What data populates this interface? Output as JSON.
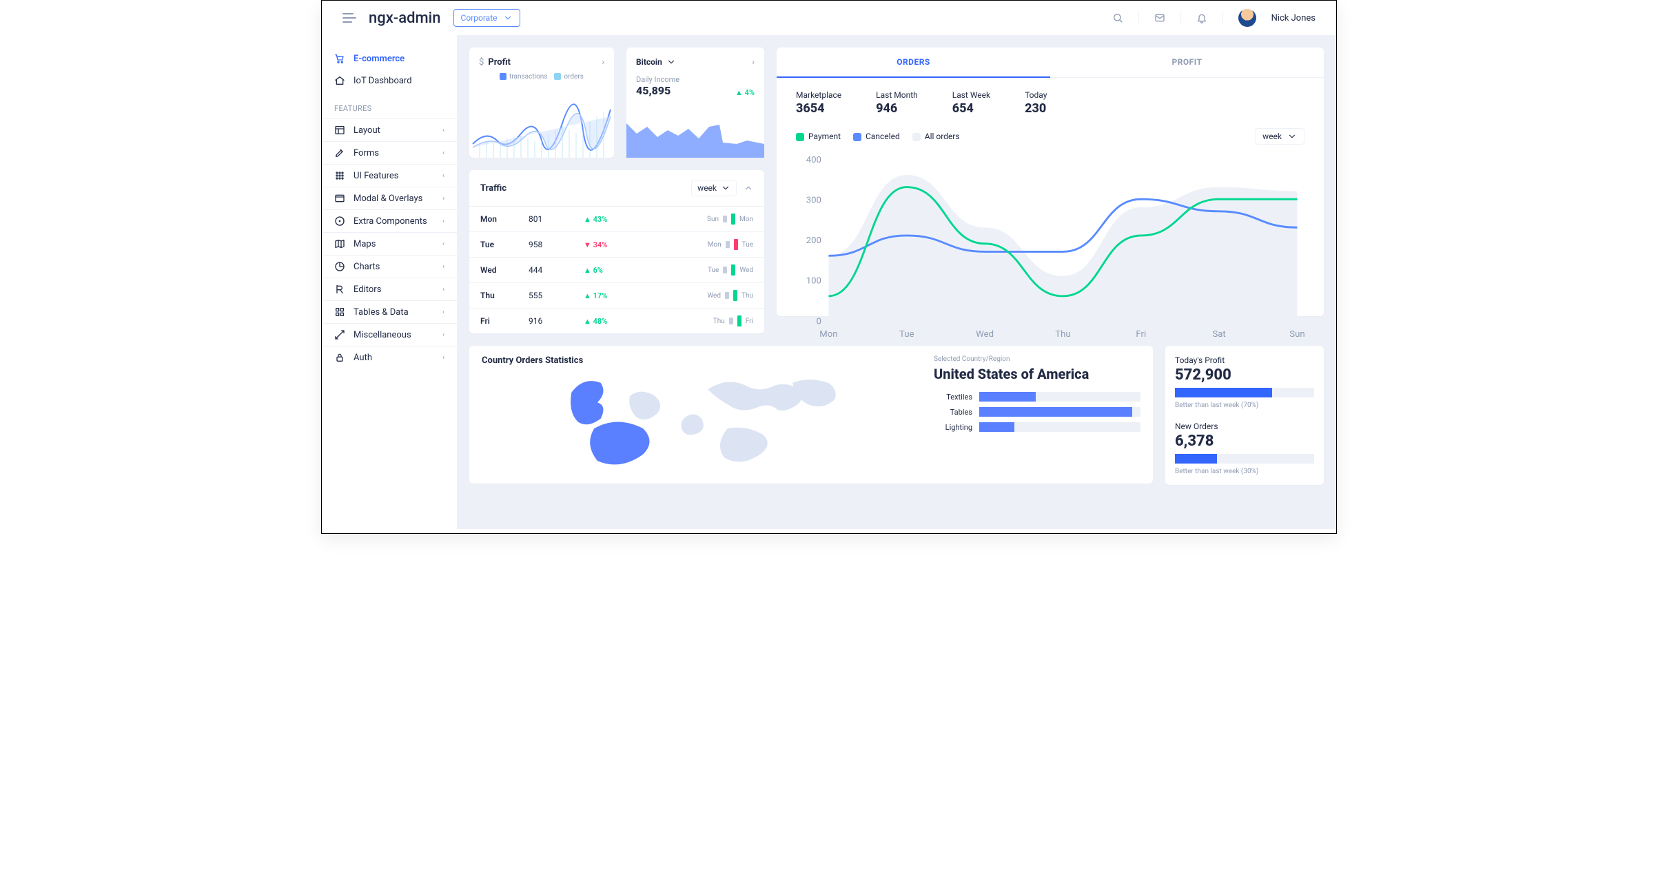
{
  "header": {
    "brand": "ngx-admin",
    "theme": "Corporate",
    "user": "Nick Jones"
  },
  "sidebar": {
    "items_top": [
      {
        "icon": "cart",
        "label": "E-commerce",
        "active": true
      },
      {
        "icon": "home",
        "label": "IoT Dashboard"
      }
    ],
    "features_label": "FEATURES",
    "items_features": [
      {
        "icon": "layout",
        "label": "Layout",
        "expandable": true
      },
      {
        "icon": "forms",
        "label": "Forms",
        "expandable": true
      },
      {
        "icon": "uif",
        "label": "UI Features",
        "expandable": true
      },
      {
        "icon": "modal",
        "label": "Modal & Overlays",
        "expandable": true
      },
      {
        "icon": "extra",
        "label": "Extra Components",
        "expandable": true
      },
      {
        "icon": "maps",
        "label": "Maps",
        "expandable": true
      },
      {
        "icon": "charts",
        "label": "Charts",
        "expandable": true
      },
      {
        "icon": "editors",
        "label": "Editors",
        "expandable": true
      },
      {
        "icon": "tables",
        "label": "Tables & Data",
        "expandable": true
      },
      {
        "icon": "misc",
        "label": "Miscellaneous",
        "expandable": true
      },
      {
        "icon": "auth",
        "label": "Auth",
        "expandable": true
      }
    ]
  },
  "profit": {
    "title": "Profit",
    "legend": [
      "transactions",
      "orders"
    ]
  },
  "bitcoin": {
    "coin": "Bitcoin",
    "daily_income_label": "Daily Income",
    "daily_income_value": "45,895",
    "change": "4%"
  },
  "traffic": {
    "title": "Traffic",
    "range": "week",
    "rows": [
      {
        "day": "Mon",
        "value": "801",
        "pct": "43%",
        "dir": "up",
        "prev": "Sun",
        "cur": "Mon"
      },
      {
        "day": "Tue",
        "value": "958",
        "pct": "34%",
        "dir": "down",
        "prev": "Mon",
        "cur": "Tue"
      },
      {
        "day": "Wed",
        "value": "444",
        "pct": "6%",
        "dir": "up",
        "prev": "Tue",
        "cur": "Wed"
      },
      {
        "day": "Thu",
        "value": "555",
        "pct": "17%",
        "dir": "up",
        "prev": "Wed",
        "cur": "Thu"
      },
      {
        "day": "Fri",
        "value": "916",
        "pct": "48%",
        "dir": "up",
        "prev": "Thu",
        "cur": "Fri"
      }
    ]
  },
  "orders": {
    "tabs": [
      "ORDERS",
      "PROFIT"
    ],
    "active_tab": 0,
    "stats": [
      {
        "label": "Marketplace",
        "value": "3654"
      },
      {
        "label": "Last Month",
        "value": "946"
      },
      {
        "label": "Last Week",
        "value": "654"
      },
      {
        "label": "Today",
        "value": "230"
      }
    ],
    "legend": [
      {
        "color": "#00d68f",
        "label": "Payment"
      },
      {
        "color": "#598bff",
        "label": "Canceled"
      },
      {
        "color": "#edf1f7",
        "label": "All orders"
      }
    ],
    "range": "week"
  },
  "map": {
    "title": "Country Orders Statistics",
    "selected_label": "Selected Country/Region",
    "country": "United States of America",
    "bars": [
      {
        "label": "Textiles",
        "pct": 35
      },
      {
        "label": "Tables",
        "pct": 95
      },
      {
        "label": "Lighting",
        "pct": 22
      }
    ]
  },
  "side": {
    "profit": {
      "label": "Today's Profit",
      "value": "572,900",
      "note": "Better than last week (70%)",
      "pct": 70
    },
    "orders": {
      "label": "New Orders",
      "value": "6,378",
      "note": "Better than last week (30%)",
      "pct": 30
    }
  },
  "chart_data": [
    {
      "type": "line",
      "title": "Orders",
      "categories": [
        "Mon",
        "Tue",
        "Wed",
        "Thu",
        "Fri",
        "Sat",
        "Sun"
      ],
      "ylim": [
        0,
        400
      ],
      "yticks": [
        0,
        100,
        200,
        300,
        400
      ],
      "series": [
        {
          "name": "Payment",
          "color": "#00d68f",
          "values": [
            60,
            330,
            190,
            60,
            210,
            300,
            300
          ]
        },
        {
          "name": "Canceled",
          "color": "#598bff",
          "values": [
            160,
            210,
            170,
            170,
            300,
            270,
            230
          ]
        },
        {
          "name": "All orders",
          "color": "#edf1f7",
          "values": [
            160,
            360,
            230,
            110,
            280,
            330,
            320
          ]
        }
      ]
    },
    {
      "type": "bar",
      "title": "Country category breakdown",
      "categories": [
        "Textiles",
        "Tables",
        "Lighting"
      ],
      "values": [
        35,
        95,
        22
      ]
    }
  ]
}
